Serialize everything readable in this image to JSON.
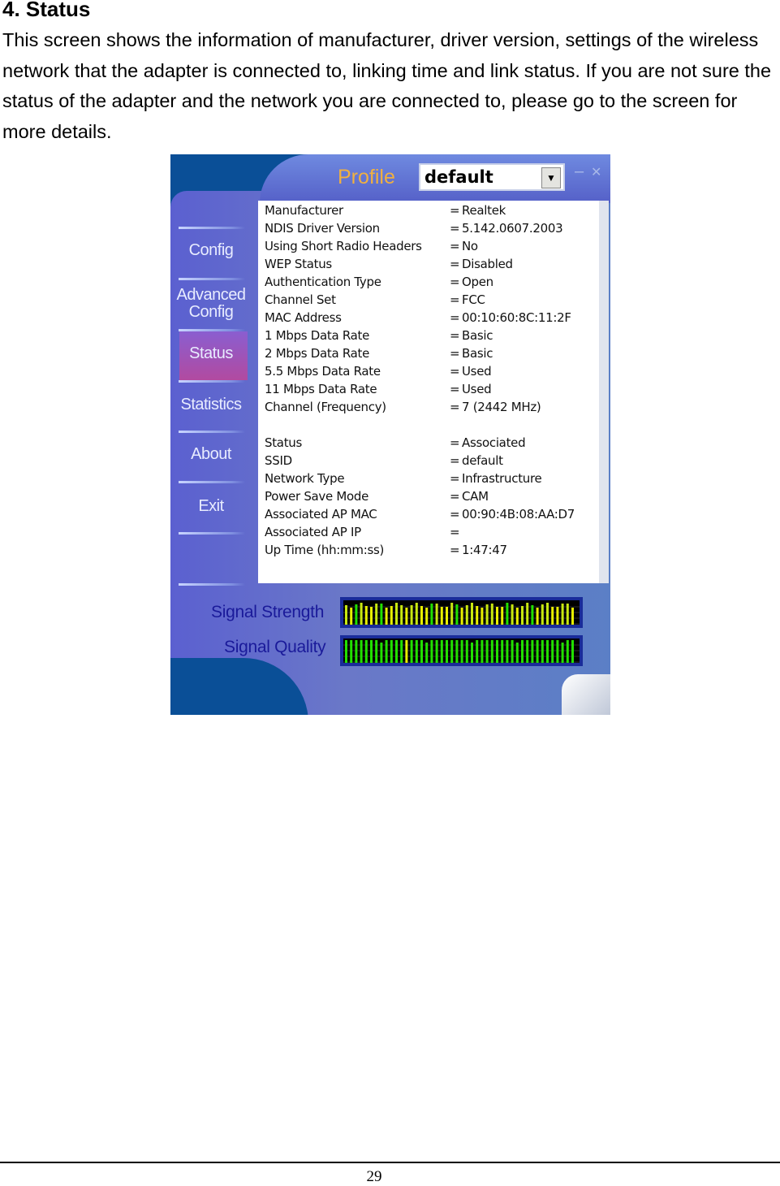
{
  "heading": "4. Status",
  "paragraph": "This screen shows the information of manufacturer, driver version, settings of the wireless network that the adapter is connected to, linking time and link status. If you are not sure the status of the adapter and the network you are connected to, please go to the screen for more details.",
  "app": {
    "profile_label": "Profile",
    "profile_value": "default",
    "minimize": "–",
    "close": "✕",
    "nav": [
      {
        "label": "Config"
      },
      {
        "label": "Advanced Config"
      },
      {
        "label": "Status",
        "active": true
      },
      {
        "label": "Statistics"
      },
      {
        "label": "About"
      },
      {
        "label": "Exit"
      }
    ],
    "info_rows": [
      {
        "label": "Manufacturer",
        "value": "Realtek"
      },
      {
        "label": "NDIS Driver Version",
        "value": "5.142.0607.2003"
      },
      {
        "label": "Using Short Radio Headers",
        "value": "No"
      },
      {
        "label": "WEP Status",
        "value": "Disabled"
      },
      {
        "label": "Authentication Type",
        "value": "Open"
      },
      {
        "label": "Channel Set",
        "value": "FCC"
      },
      {
        "label": "MAC Address",
        "value": "00:10:60:8C:11:2F"
      },
      {
        "label": "1 Mbps Data Rate",
        "value": "Basic"
      },
      {
        "label": "2 Mbps Data Rate",
        "value": "Basic"
      },
      {
        "label": "5.5 Mbps Data Rate",
        "value": "Used"
      },
      {
        "label": "11 Mbps Data Rate",
        "value": "Used"
      },
      {
        "label": "Channel (Frequency)",
        "value": "7 (2442 MHz)"
      }
    ],
    "status_rows": [
      {
        "label": "Status",
        "value": "Associated"
      },
      {
        "label": "SSID",
        "value": "default"
      },
      {
        "label": "Network Type",
        "value": "Infrastructure"
      },
      {
        "label": "Power Save Mode",
        "value": "CAM"
      },
      {
        "label": "Associated AP MAC",
        "value": "00:90:4B:08:AA:D7"
      },
      {
        "label": "Associated AP IP",
        "value": ""
      },
      {
        "label": "Up Time (hh:mm:ss)",
        "value": "1:47:47"
      }
    ],
    "equals": "=",
    "signal_strength_label": "Signal Strength",
    "signal_quality_label": "Signal Quality",
    "colors": {
      "bar_green": "#22e000",
      "bar_yellow": "#e8f000",
      "profile": "#f0b040"
    }
  },
  "page_number": "29"
}
